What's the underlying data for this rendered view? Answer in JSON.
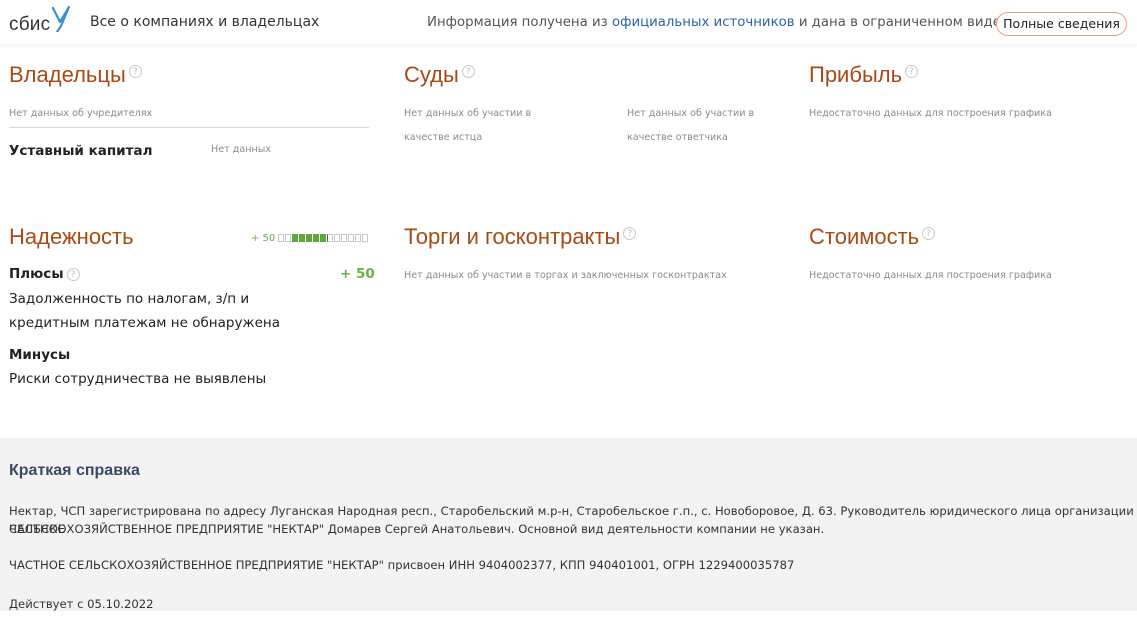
{
  "header": {
    "logo_text": "сбис",
    "tagline": "Все о компаниях и владельцах",
    "info_prefix": "Информация получена из",
    "info_link": "официальных источников",
    "info_suffix": "и дана в ограниченном виде",
    "full_button": "Полные сведения"
  },
  "owners": {
    "title": "Владельцы",
    "no_founders": "Нет данных об учредителях",
    "capital_label": "Уставный капитал",
    "capital_value": "Нет данных"
  },
  "courts": {
    "title": "Суды",
    "plaintiff_line1": "Нет данных об участии в",
    "plaintiff_line2": "качестве истца",
    "defendant_line1": "Нет данных об участии в",
    "defendant_line2": "качестве ответчика"
  },
  "profit": {
    "title": "Прибыль",
    "note": "Недостаточно данных для построения графика"
  },
  "reliability": {
    "title": "Надежность",
    "score": "+ 50",
    "scale_filled_from": 3,
    "scale_filled_to": 7,
    "scale_total": 13,
    "plus_label": "Плюсы",
    "plus_score": "+ 50",
    "plus_text_line1": "Задолженность по налогам, з/п и",
    "plus_text_line2": "кредитным платежам не обнаружена",
    "minus_label": "Минусы",
    "minus_text": "Риски сотрудничества не выявлены"
  },
  "tenders": {
    "title": "Торги и госконтракты",
    "note": "Нет данных об участии в торгах и заключенных госконтрактах"
  },
  "value": {
    "title": "Стоимость",
    "note": "Недостаточно данных для построения графика"
  },
  "summary": {
    "title": "Краткая справка",
    "paragraph1_line1": "Нектар, ЧСП зарегистрирована по адресу Луганская Народная респ., Старобельский м.р-н, Старобельское г.п., с. Новоборовое, Д. 63. Руководитель юридического лица организации ЧАСТНОЕ",
    "paragraph1_line2": "СЕЛЬСКОХОЗЯЙСТВЕННОЕ ПРЕДПРИЯТИЕ \"НЕКТАР\" Домарев Сергей Анатольевич. Основной вид деятельности компании не указан.",
    "paragraph2": "ЧАСТНОЕ СЕЛЬСКОХОЗЯЙСТВЕННОЕ ПРЕДПРИЯТИЕ \"НЕКТАР\" присвоен ИНН 9404002377, КПП 940401001, ОГРН 1229400035787",
    "active_since": "Действует с 05.10.2022"
  },
  "colors": {
    "accent": "#a84a15",
    "link": "#2a64a6",
    "positive": "#5fa83c"
  }
}
